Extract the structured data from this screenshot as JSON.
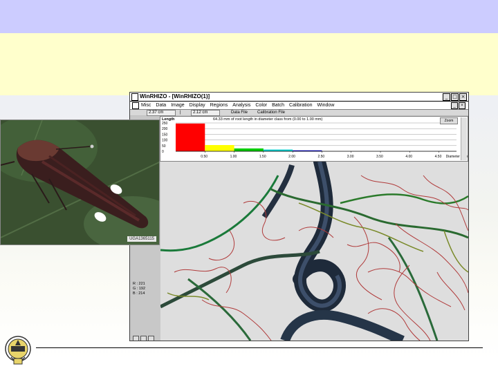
{
  "app": {
    "title": "WinRHIZO - [WinRHIZO(1)]",
    "menus": [
      "Misc",
      "Data",
      "Image",
      "Display",
      "Regions",
      "Analysis",
      "Color",
      "Batch",
      "Calibration",
      "Window"
    ],
    "window_buttons": [
      "_",
      "□",
      "×"
    ],
    "mdi_buttons": [
      "_",
      "×"
    ]
  },
  "toolbar": {
    "field1": "2.37 cm",
    "sep": "|",
    "field2": "2.12 cm",
    "data_file": "Data File",
    "calib_file": "Calibration File"
  },
  "histogram": {
    "heading": "64.33 mm of root length in diameter class from (0.00 to 1.00 mm)",
    "zoom_label": "Zoom",
    "ylabel": "Length"
  },
  "chart_data": {
    "type": "bar",
    "ylabel": "Length",
    "xlabel": "Diameter (mm)",
    "y_ticks": [
      "250",
      "200",
      "150",
      "100",
      "50",
      "0"
    ],
    "x_ticks": [
      "0.50",
      "1.00",
      "1.50",
      "2.00",
      "2.50",
      "3.00",
      "3.50",
      "4.00",
      "4.50"
    ],
    "ylim": [
      0,
      250
    ],
    "xlim": [
      0,
      4.8
    ],
    "categories": [
      "0.0-0.5",
      "0.5-1.0",
      "1.0-1.5",
      "1.5-2.0",
      "2.0-2.5",
      "2.5-3.0",
      "3.0-3.5",
      "3.5-4.0",
      "4.0-4.5"
    ],
    "values": [
      245,
      55,
      25,
      15,
      8,
      0,
      0,
      0,
      0
    ],
    "bar_colors": [
      "#ff0000",
      "#ffff00",
      "#00cc00",
      "#00cccc",
      "#0000cc",
      "#888888",
      "#888888",
      "#888888",
      "#888888"
    ]
  },
  "stats": {
    "r": "R : 221",
    "g": "G : 192",
    "b": "B : 214"
  },
  "photo": {
    "caption": "UGA1365115"
  },
  "colors": {
    "top_band": "#ccccff",
    "title_band": "#ffffcc"
  }
}
